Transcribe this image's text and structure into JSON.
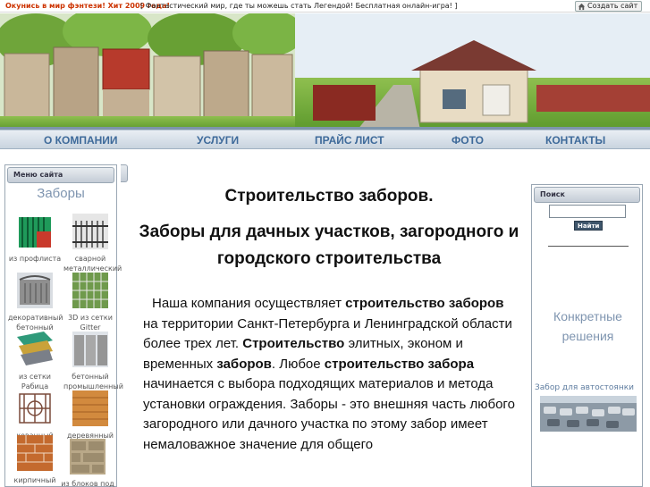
{
  "topbar": {
    "ad_primary": "Окунись в мир фэнтези! Хит 2009 года!",
    "ad_secondary": "[ Фантастический мир, где ты можешь стать Легендой! Бесплатная онлайн-игра! ]",
    "create_site_label": "Создать сайт",
    "create_site_icon": "home-icon"
  },
  "nav": {
    "items": [
      "О КОМПАНИИ",
      "УСЛУГИ",
      "ПРАЙС ЛИСТ",
      "ФОТО",
      "КОНТАКТЫ"
    ]
  },
  "left_menu": {
    "header": "Меню сайта",
    "title": "Заборы",
    "categories": [
      {
        "label": "из профлиста",
        "icon": "profiled-sheet-fence-icon"
      },
      {
        "label": "сварной металлический",
        "icon": "welded-metal-fence-icon"
      },
      {
        "label": "декоративный бетонный",
        "icon": "decorative-concrete-fence-icon"
      },
      {
        "label": "3D из сетки Gitter",
        "icon": "3d-mesh-fence-icon"
      },
      {
        "label": "из сетки Рабица",
        "icon": "chain-link-fence-icon"
      },
      {
        "label": "бетонный промышленный",
        "icon": "industrial-concrete-fence-icon"
      },
      {
        "label": "кованный",
        "icon": "wrought-iron-fence-icon"
      },
      {
        "label": "деревянный",
        "icon": "wooden-fence-icon"
      },
      {
        "label": "кирпичный",
        "icon": "brick-fence-icon"
      },
      {
        "label": "из блоков под рубленный камень",
        "icon": "stone-block-fence-icon"
      }
    ]
  },
  "main": {
    "title": "Строительство заборов.",
    "subtitle": "Заборы для дачных участков, загородного и городского строительства",
    "paragraph": {
      "parts": [
        {
          "text": "Наша компания осуществляет ",
          "bold": false
        },
        {
          "text": "строительство заборов",
          "bold": true
        },
        {
          "text": " на территории Санкт-Петербурга и Ленинградской области более трех лет. ",
          "bold": false
        },
        {
          "text": "Строительство",
          "bold": true
        },
        {
          "text": " элитных, эконом и временных ",
          "bold": false
        },
        {
          "text": "заборов",
          "bold": true
        },
        {
          "text": ". Любое ",
          "bold": false
        },
        {
          "text": "строительство забора",
          "bold": true
        },
        {
          "text": " начинается с выбора подходящих материалов и метода установки ограждения. Заборы - это внешняя часть любого загородного или дачного участка по этому забор имеет немаловажное значение для общего",
          "bold": false
        }
      ]
    }
  },
  "right_panel": {
    "header": "Поиск",
    "search_value": "",
    "search_button": "Найти",
    "solutions_title": "Конкретные решения",
    "link_text": "Забор для автостоянки"
  },
  "colors": {
    "nav_text": "#3e6a9a",
    "sidebar_title": "#7f95b0",
    "ad_text": "#cc3300",
    "link": "#5f7da0"
  }
}
